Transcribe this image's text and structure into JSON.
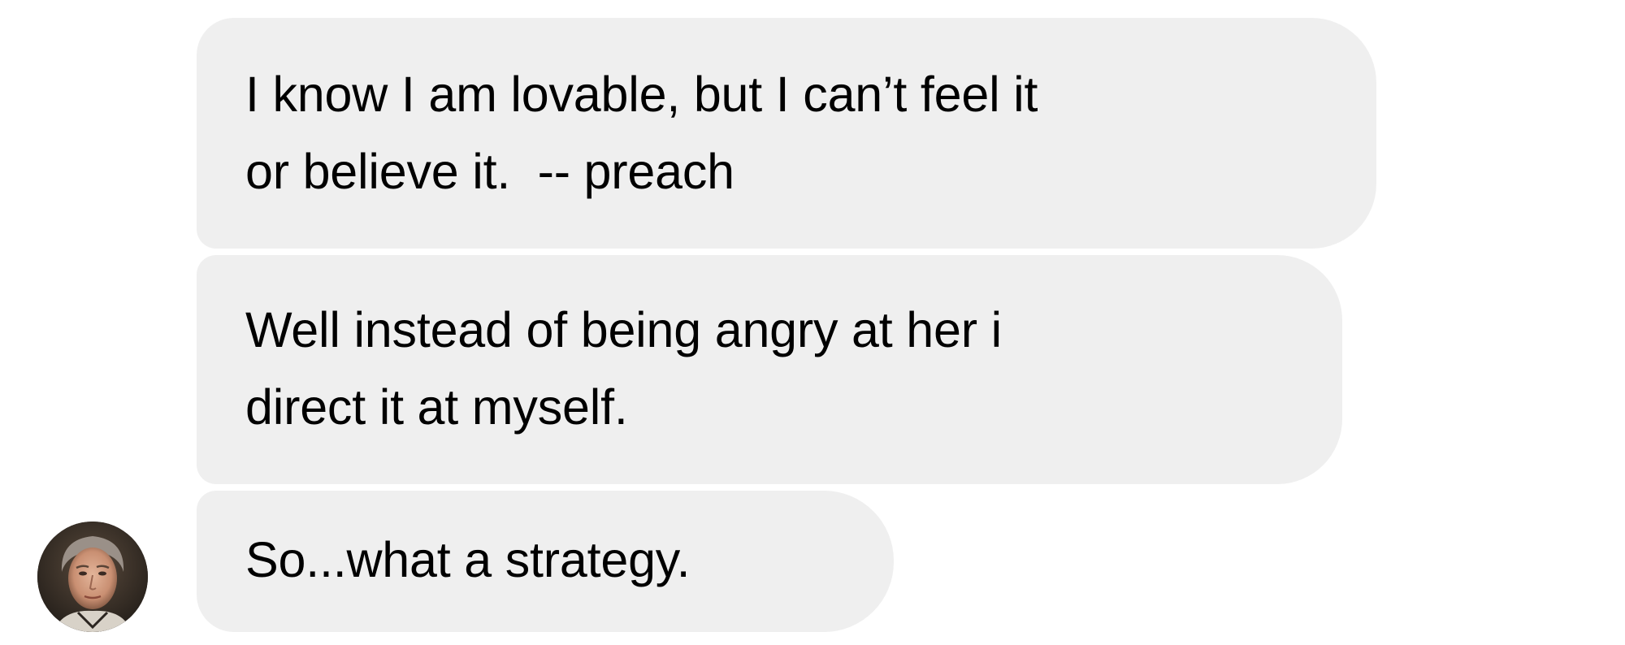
{
  "conversation": {
    "messages": [
      {
        "text": "I know I am lovable, but I can’t feel it\nor believe it.  -- preach"
      },
      {
        "text": "Well instead of being angry at her i\ndirect it at myself."
      },
      {
        "text": "So...what a strategy."
      }
    ],
    "sender": {
      "avatar_icon": "person-portrait-avatar"
    },
    "colors": {
      "bubble_background": "#efefef",
      "text": "#000000",
      "background": "#ffffff"
    }
  }
}
